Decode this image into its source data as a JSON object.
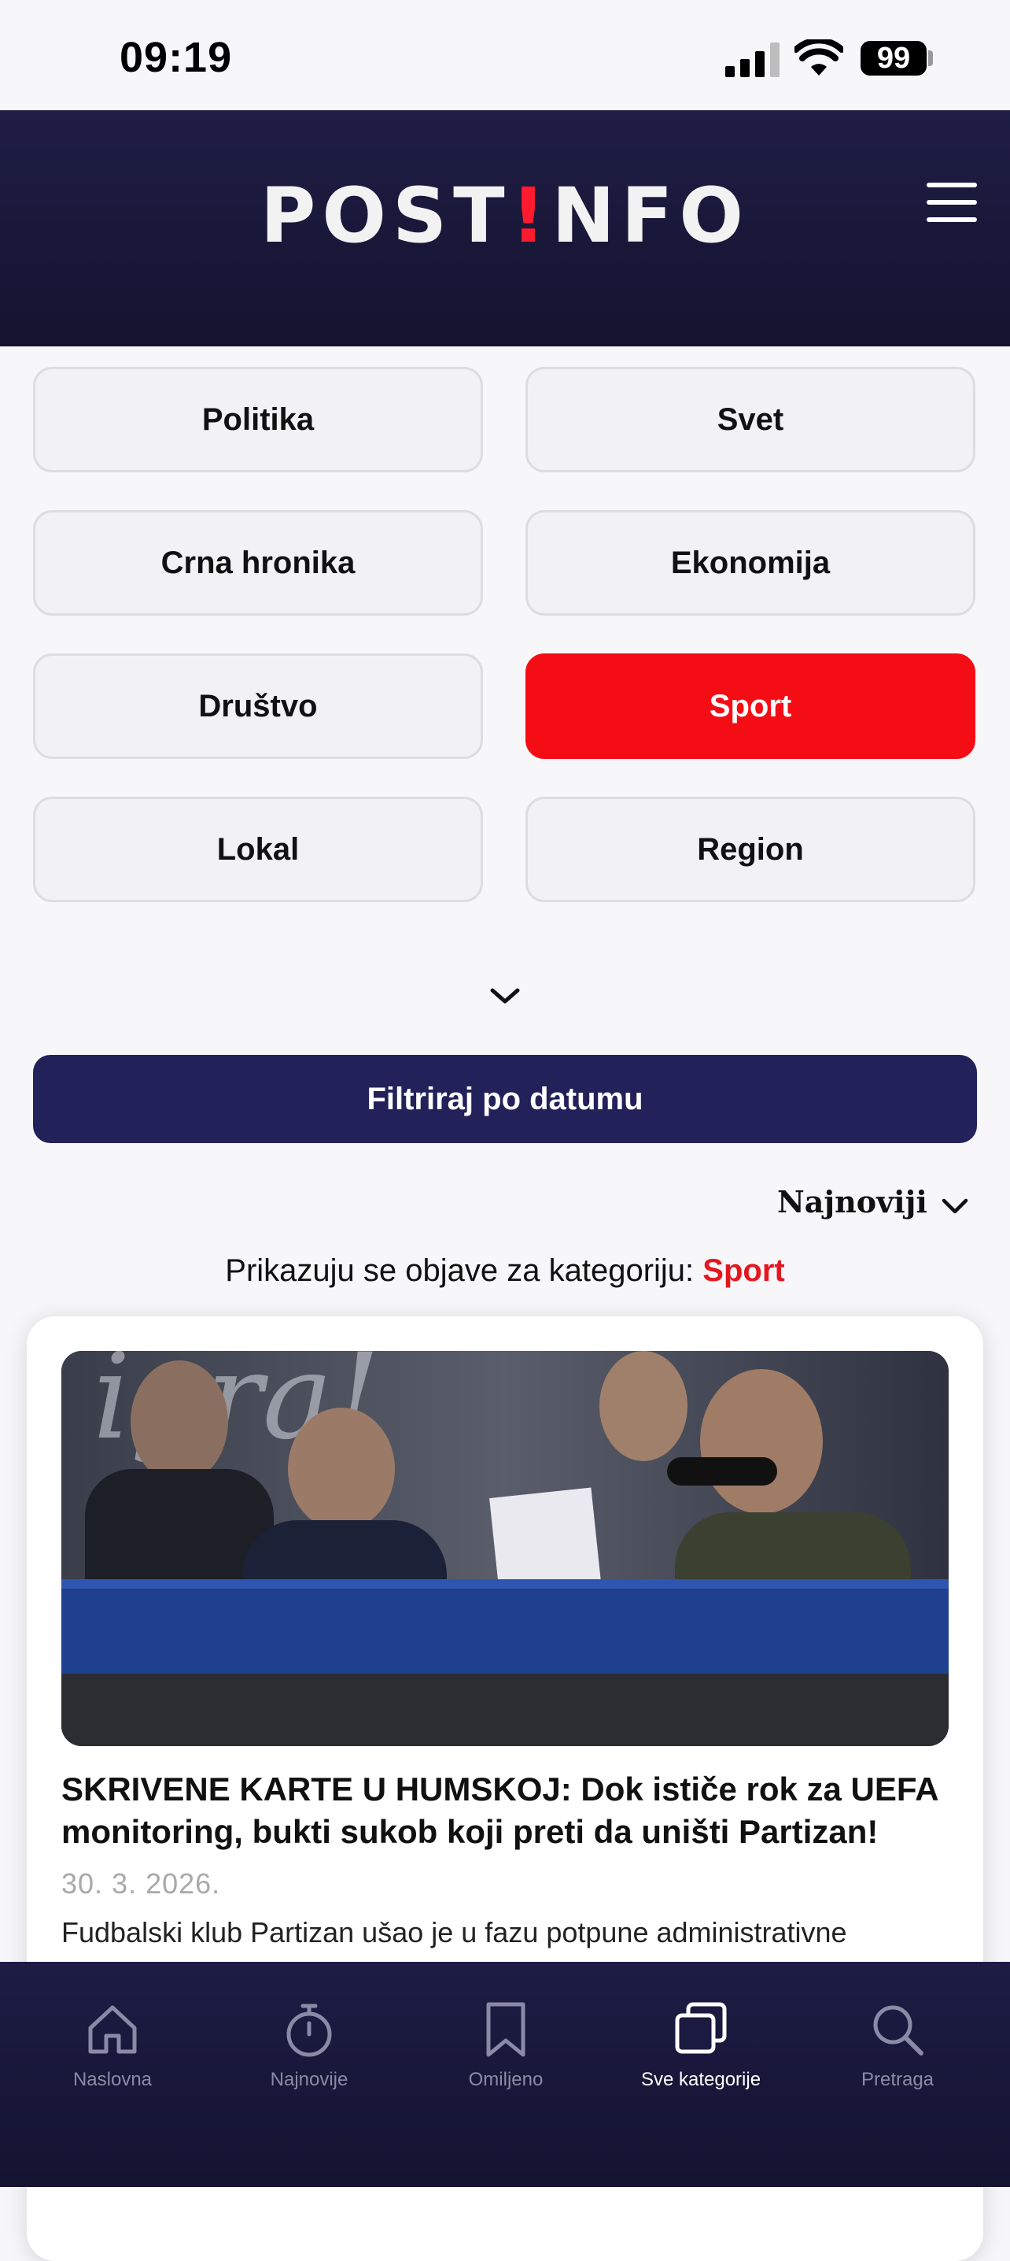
{
  "status_bar": {
    "time": "09:19",
    "battery": "99"
  },
  "header": {
    "logo_left": "POST",
    "logo_mark": "!",
    "logo_right": "NFO"
  },
  "categories": [
    {
      "label": "Politika",
      "active": false
    },
    {
      "label": "Svet",
      "active": false
    },
    {
      "label": "Crna hronika",
      "active": false
    },
    {
      "label": "Ekonomija",
      "active": false
    },
    {
      "label": "Društvo",
      "active": false
    },
    {
      "label": "Sport",
      "active": true
    },
    {
      "label": "Lokal",
      "active": false
    },
    {
      "label": "Region",
      "active": false
    }
  ],
  "filter_button": "Filtriraj po datumu",
  "sort": {
    "label": "Najnoviji"
  },
  "showing": {
    "prefix": "Prikazuju se objave za kategoriju:",
    "category": "Sport"
  },
  "article": {
    "title": "SKRIVENE KARTE U HUMSKOJ: Dok ističe rok za UEFA monitoring, bukti sukob koji preti da uništi Partizan!",
    "date": "30. 3. 2026.",
    "excerpt": "Fudbalski klub Partizan ušao je u fazu potpune administrativne"
  },
  "bottom_nav": [
    {
      "label": "Naslovna",
      "icon": "home-icon"
    },
    {
      "label": "Najnovije",
      "icon": "stopwatch-icon"
    },
    {
      "label": "Omiljeno",
      "icon": "bookmark-icon"
    },
    {
      "label": "Sve kategorije",
      "icon": "categories-icon",
      "active": true
    },
    {
      "label": "Pretraga",
      "icon": "search-icon"
    }
  ],
  "colors": {
    "accent": "#f50d16",
    "navy": "#22215a",
    "header": "#1f1d45"
  }
}
